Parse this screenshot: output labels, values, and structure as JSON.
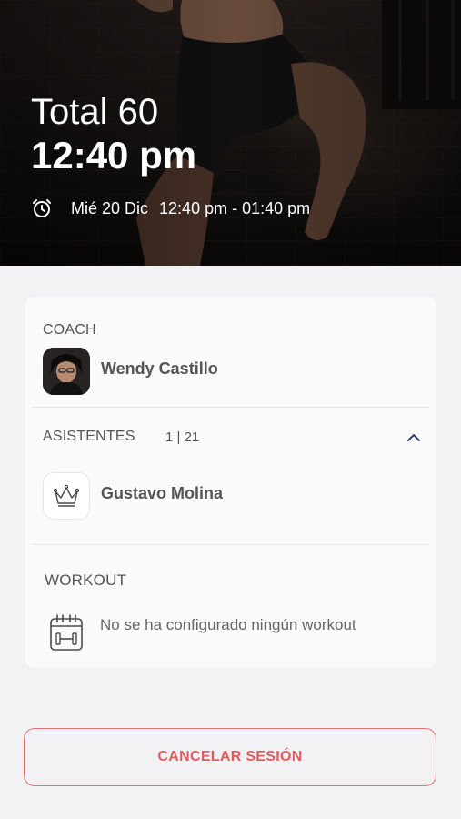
{
  "hero": {
    "class_name": "Total 60",
    "start_time": "12:40 pm",
    "date": "Mié 20 Dic",
    "time_range": "12:40 pm - 01:40 pm",
    "schedule_icon": "alarm-clock-icon"
  },
  "coach": {
    "label": "COACH",
    "name": "Wendy  Castillo"
  },
  "attendees": {
    "label": "ASISTENTES",
    "count": "1 | 21",
    "toggle_icon": "chevron-up-icon",
    "list": [
      {
        "name": "Gustavo Molina",
        "icon": "crown-icon"
      }
    ]
  },
  "workout": {
    "label": "WORKOUT",
    "icon": "calendar-dumbbell-icon",
    "empty_message": "No se ha configurado ningún workout"
  },
  "actions": {
    "cancel_label": "CANCELAR SESIÓN"
  },
  "colors": {
    "accent_red": "#e45b5b",
    "chevron_blue": "#2f3f70",
    "background": "#f2f2f4"
  }
}
